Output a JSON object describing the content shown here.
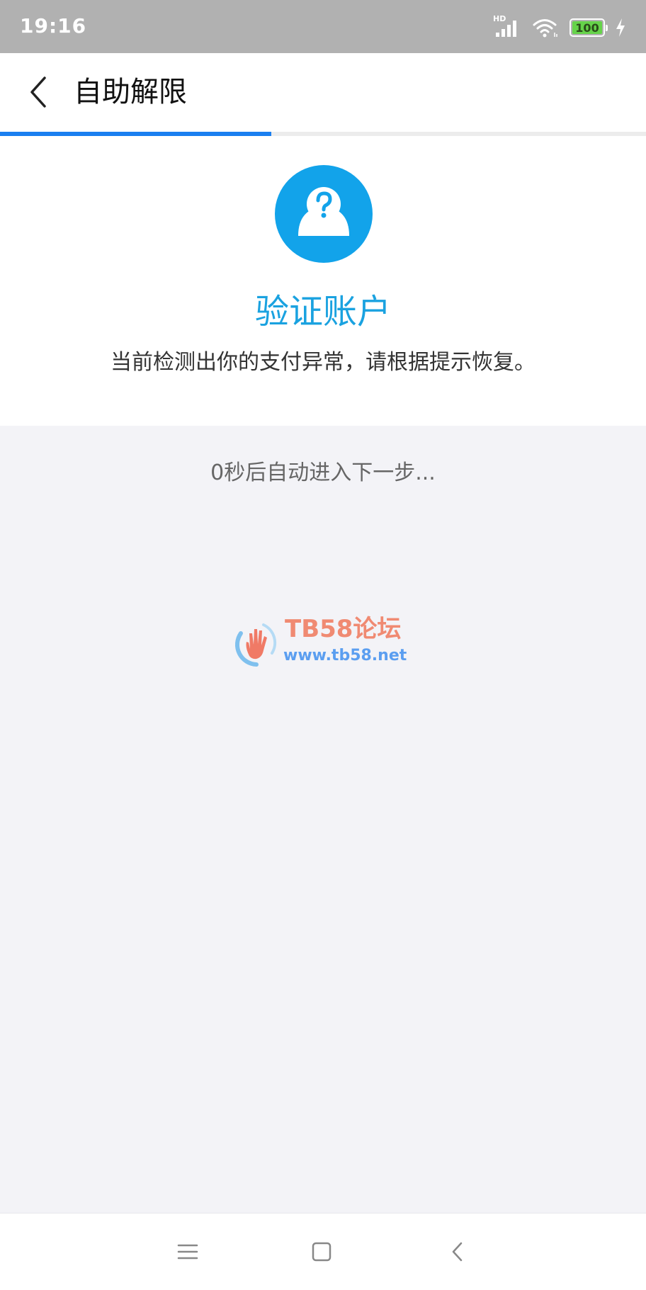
{
  "status_bar": {
    "time": "19:16",
    "network_label": "HD",
    "battery_level": "100",
    "icons": [
      "signal-icon",
      "wifi-icon",
      "battery-icon",
      "charging-icon"
    ]
  },
  "header": {
    "title": "自助解限",
    "progress": 0.42
  },
  "verify": {
    "icon": "user-question-icon",
    "title": "验证账户",
    "description": "当前检测出你的支付异常，请根据提示恢复。"
  },
  "countdown": {
    "text": "0秒后自动进入下一步..."
  },
  "watermark": {
    "title": "TB58论坛",
    "url": "www.tb58.net"
  },
  "nav_bar": {
    "icons": [
      "menu-icon",
      "home-icon",
      "back-icon"
    ]
  },
  "colors": {
    "accent_blue": "#1a7ff0",
    "icon_blue": "#12a3ea",
    "title_blue": "#1aa2e0",
    "status_bar": "#b1b1b1",
    "page_bg": "#f3f3f7"
  }
}
